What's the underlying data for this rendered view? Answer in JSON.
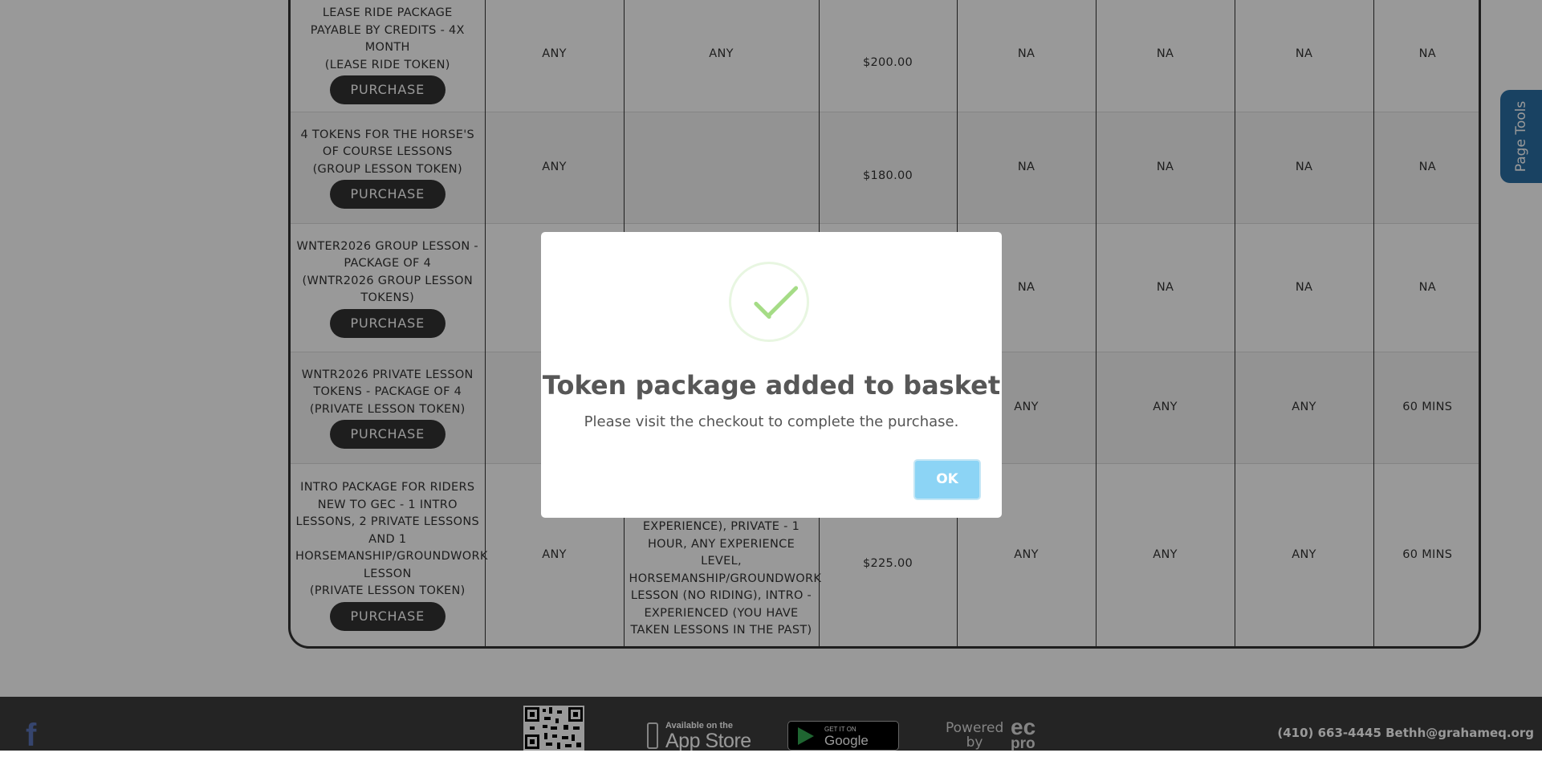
{
  "table": {
    "rows": [
      {
        "name": "LEASE RIDE PACKAGE PAYABLE BY CREDITS - 4X MONTH",
        "token": "(LEASE RIDE TOKEN)",
        "purchase_label": "PURCHASE",
        "c1": "ANY",
        "c2": "ANY",
        "price": "$200.00",
        "c4": "NA",
        "c5": "NA",
        "c6": "NA",
        "c7": "NA"
      },
      {
        "name": "4 TOKENS FOR THE HORSE'S OF COURSE LESSONS",
        "token": "(GROUP LESSON TOKEN)",
        "purchase_label": "PURCHASE",
        "c1": "ANY",
        "c2": "",
        "price": "$180.00",
        "c4": "NA",
        "c5": "NA",
        "c6": "NA",
        "c7": "NA"
      },
      {
        "name": "WNTER2026 GROUP LESSON - PACKAGE OF 4",
        "token": "(WNTR2026 GROUP LESSON TOKENS)",
        "purchase_label": "PURCHASE",
        "c1": "",
        "c2": "",
        "price": "",
        "c4": "NA",
        "c5": "NA",
        "c6": "NA",
        "c7": "NA"
      },
      {
        "name": "WNTR2026 PRIVATE LESSON TOKENS - PACKAGE OF 4",
        "token": "(PRIVATE LESSON TOKEN)",
        "purchase_label": "PURCHASE",
        "c1": "",
        "c2": "",
        "price": "",
        "c4": "ANY",
        "c5": "ANY",
        "c6": "ANY",
        "c7": "60 MINS"
      },
      {
        "name": "INTRO PACKAGE FOR RIDERS NEW TO GEC - 1 INTRO LESSONS, 2 PRIVATE LESSONS AND 1 HORSEMANSHIP/GROUNDWORK LESSON",
        "token": "(PRIVATE LESSON TOKEN)",
        "purchase_label": "PURCHASE",
        "c1": "ANY",
        "c2": "EXPERIENCE), PRIVATE - 1 HOUR, ANY EXPERIENCE LEVEL, HORSEMANSHIP/GROUNDWORK LESSON (NO RIDING), INTRO - EXPERIENCED (YOU HAVE TAKEN LESSONS IN THE PAST)",
        "price": "$225.00",
        "c4": "ANY",
        "c5": "ANY",
        "c6": "ANY",
        "c7": "60 MINS"
      }
    ]
  },
  "page_tools": {
    "label": "Page Tools"
  },
  "footer": {
    "facebook_glyph": "f",
    "app_store_sub": "Available on the",
    "app_store_main": "App Store",
    "google_play_sub": "GET IT ON",
    "google_play_main": "Google Play",
    "powered_by": "Powered by",
    "logo_top": "ec",
    "logo_bottom": "pro",
    "contact": "(410) 663-4445 Bethh@grahameq.org"
  },
  "dialog": {
    "title": "Token package added to basket",
    "message": "Please visit the checkout to complete the purchase.",
    "ok_label": "OK",
    "icon": "success-check-icon",
    "success_color": "#a5dc86",
    "button_color": "#8cd4f5"
  }
}
